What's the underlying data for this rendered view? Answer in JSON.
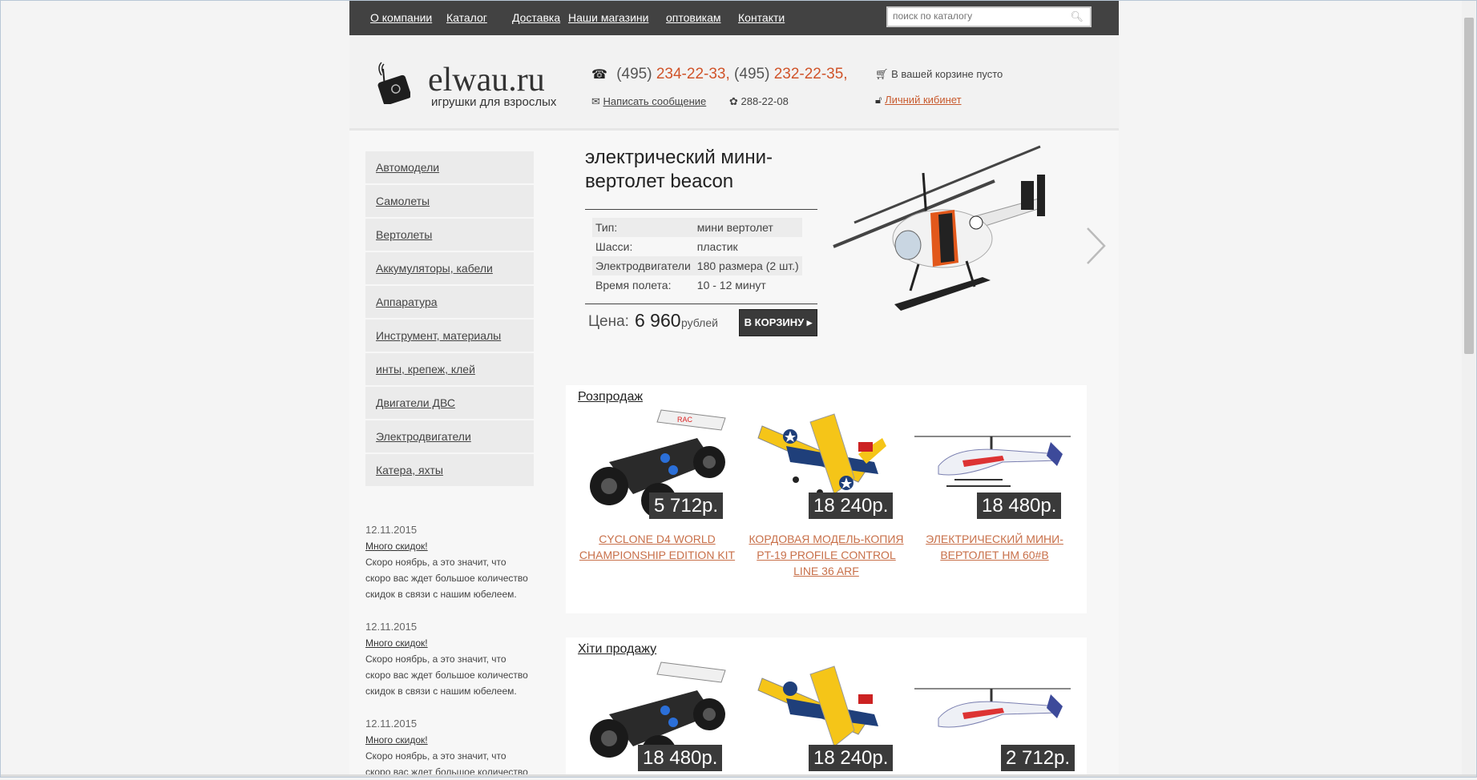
{
  "nav": {
    "links": [
      "О компании",
      "Каталог",
      "Доставка",
      "Наши магазини",
      "оптовикам",
      "Контакти"
    ],
    "search_placeholder": "поиск по каталогу"
  },
  "header": {
    "logo_text": "elwau.ru",
    "logo_subtitle": "игрушки для взрослых",
    "phone_code1": "(495)",
    "phone_num1": "234-22-33,",
    "phone_code2": "(495)",
    "phone_num2": "232-22-35,",
    "message_link": "Написать сообщение",
    "icq": "288-22-08",
    "cart_text": "В вашей корзине пусто",
    "cabinet_link": "Личний кибинет"
  },
  "sidebar": {
    "items": [
      "Автомодели",
      "Самолеты",
      "Вертолеты",
      "Аккумуляторы, кабели",
      "Аппаратура",
      "Инструмент, материалы",
      "инты, крепеж, клей",
      "Двигатели ДВС",
      "Электродвигатели",
      "Катера, яхты"
    ]
  },
  "news": [
    {
      "date": "12.11.2015",
      "title": "Много скидок!",
      "text": "Скоро ноябрь, а это значит, что скоро вас ждет большое количество скидок в связи с нашим юбелеем."
    },
    {
      "date": "12.11.2015",
      "title": "Много скидок!",
      "text": "Скоро ноябрь, а это значит, что скоро вас ждет большое количество скидок в связи с нашим юбелеем."
    },
    {
      "date": "12.11.2015",
      "title": "Много скидок!",
      "text": "Скоро ноябрь, а это значит, что скоро вас ждет большое количество"
    }
  ],
  "featured": {
    "title": "электрический мини-вертолет beacon",
    "specs": [
      {
        "key": "Тип:",
        "value": "мини вертолет"
      },
      {
        "key": "Шасси:",
        "value": "пластик"
      },
      {
        "key": "Электродвигатели",
        "value": "180 размера (2 шт.)"
      },
      {
        "key": "Время полета:",
        "value": "10 - 12 минут"
      }
    ],
    "price_label": "Цена:",
    "price_value": "6 960",
    "price_currency": "рублей",
    "buy_label": "В КОРЗИНУ"
  },
  "sale": {
    "title": "Розпродаж",
    "products": [
      {
        "price": "5 712р.",
        "name": "CYCLONE D4 WORLD CHAMPIONSHIP EDITION KIT",
        "icon": "buggy"
      },
      {
        "price": "18 240р.",
        "name": "КОРДОВАЯ МОДЕЛЬ-КОПИЯ PT-19 PROFILE CONTROL LINE 36 ARF",
        "icon": "plane"
      },
      {
        "price": "18 480р.",
        "name": "ЭЛЕКТРИЧЕСКИЙ МИНИ-ВЕРТОЛЕТ НМ 60#В",
        "icon": "helicopter"
      }
    ]
  },
  "hits": {
    "title": "Хіти продажу",
    "products": [
      {
        "price": "18 480р.",
        "icon": "buggy"
      },
      {
        "price": "18 240р.",
        "icon": "plane"
      },
      {
        "price": "2 712р.",
        "icon": "helicopter"
      }
    ]
  },
  "colors": {
    "nav_bg": "#424242",
    "accent": "#d0542a",
    "product_link": "#c8704a",
    "badge_bg": "#3a3a3a"
  }
}
